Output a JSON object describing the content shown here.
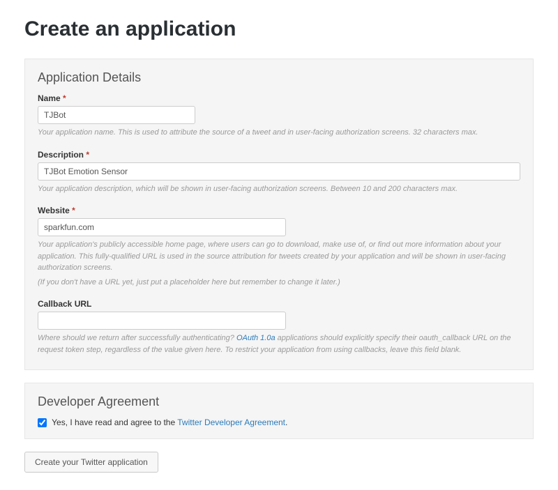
{
  "page_title": "Create an application",
  "app_details": {
    "section_title": "Application Details",
    "name": {
      "label": "Name",
      "required_mark": "*",
      "value": "TJBot",
      "help": "Your application name. This is used to attribute the source of a tweet and in user-facing authorization screens. 32 characters max."
    },
    "description": {
      "label": "Description",
      "required_mark": "*",
      "value": "TJBot Emotion Sensor",
      "help": "Your application description, which will be shown in user-facing authorization screens. Between 10 and 200 characters max."
    },
    "website": {
      "label": "Website",
      "required_mark": "*",
      "value": "sparkfun.com",
      "help1": "Your application's publicly accessible home page, where users can go to download, make use of, or find out more information about your application. This fully-qualified URL is used in the source attribution for tweets created by your application and will be shown in user-facing authorization screens.",
      "help2": "(If you don't have a URL yet, just put a placeholder here but remember to change it later.)"
    },
    "callback": {
      "label": "Callback URL",
      "value": "",
      "help_pre": "Where should we return after successfully authenticating? ",
      "help_link": "OAuth 1.0a",
      "help_post": " applications should explicitly specify their oauth_callback URL on the request token step, regardless of the value given here. To restrict your application from using callbacks, leave this field blank."
    }
  },
  "agreement": {
    "section_title": "Developer Agreement",
    "checkbox_checked": true,
    "text_pre": "Yes, I have read and agree to the ",
    "link_text": "Twitter Developer Agreement",
    "text_post": "."
  },
  "submit_label": "Create your Twitter application"
}
